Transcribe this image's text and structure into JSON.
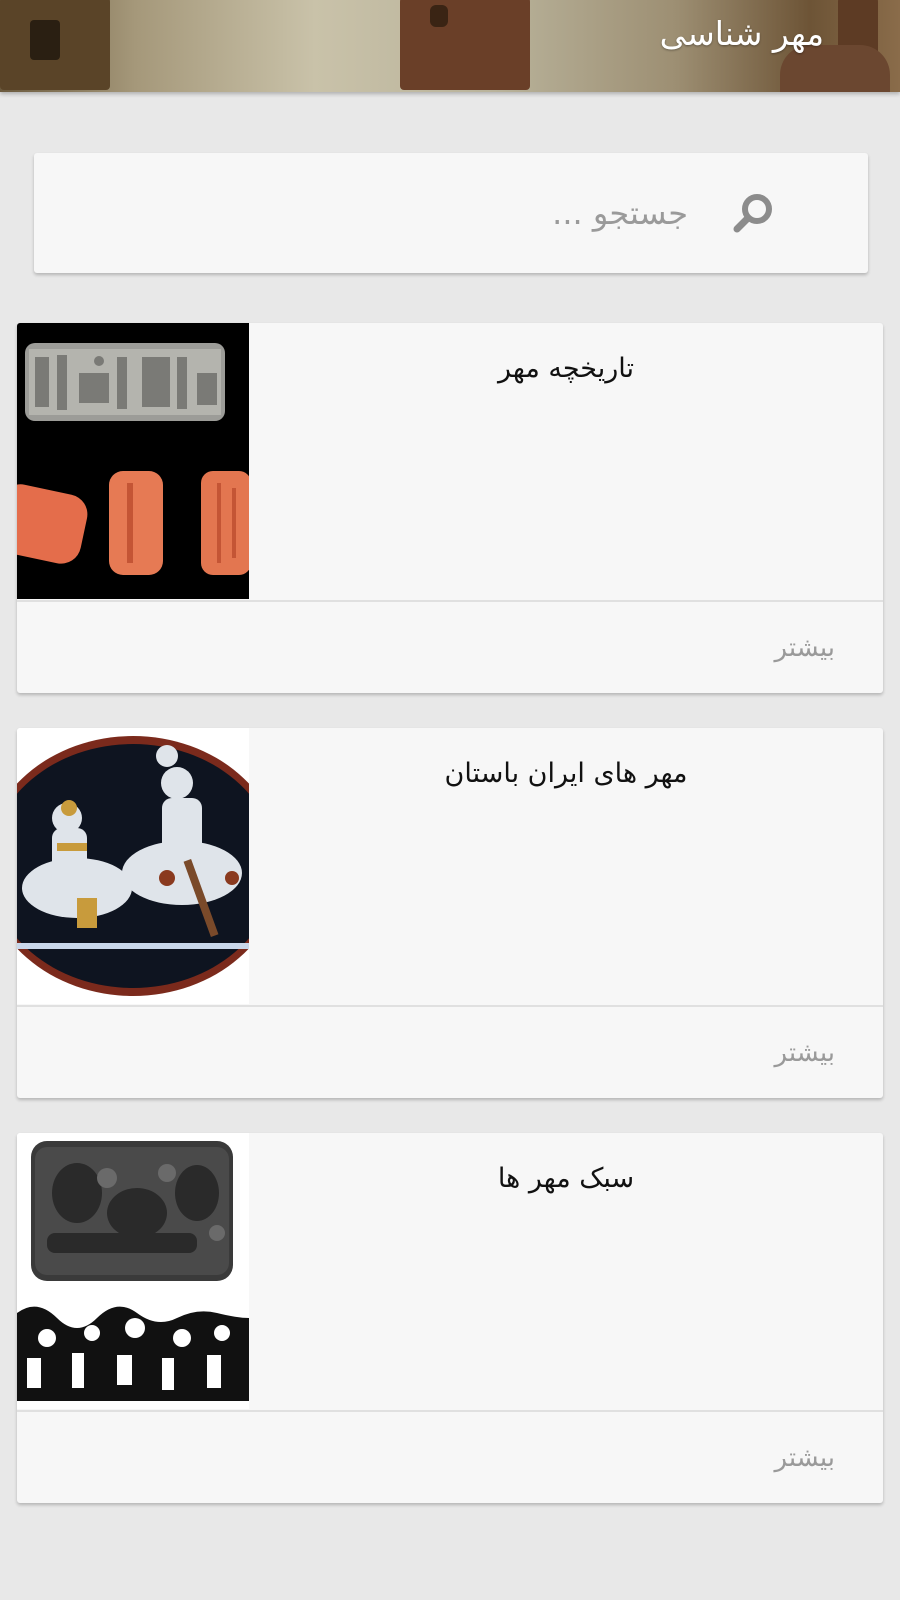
{
  "header": {
    "title": "مهر شناسی"
  },
  "search": {
    "placeholder": "جستجو ...",
    "icon": "search-icon"
  },
  "cards": [
    {
      "title": "تاریخچه مهر",
      "more_label": "بیشتر"
    },
    {
      "title": "مهر های ایران باستان",
      "more_label": "بیشتر"
    },
    {
      "title": "سبک مهر ها",
      "more_label": "بیشتر"
    }
  ],
  "colors": {
    "background": "#e8e8e8",
    "card": "#f7f7f7",
    "muted_text": "#9a9a9a"
  }
}
